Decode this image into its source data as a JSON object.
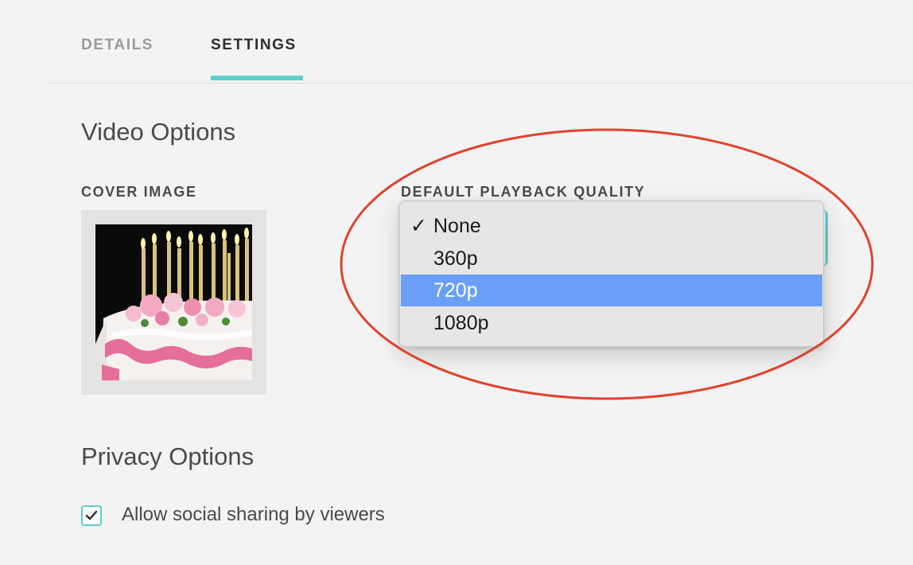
{
  "tabs": {
    "details": "DETAILS",
    "settings": "SETTINGS",
    "active": "SETTINGS"
  },
  "video_options": {
    "title": "Video Options",
    "cover_image_label": "COVER IMAGE",
    "playback_quality_label": "DEFAULT PLAYBACK QUALITY",
    "playback_quality": {
      "checked": "None",
      "highlighted": "720p",
      "options": [
        {
          "label": "None",
          "checked": true,
          "highlighted": false
        },
        {
          "label": "360p",
          "checked": false,
          "highlighted": false
        },
        {
          "label": "720p",
          "checked": false,
          "highlighted": true
        },
        {
          "label": "1080p",
          "checked": false,
          "highlighted": false
        }
      ],
      "check_glyph": "✓"
    }
  },
  "privacy_options": {
    "title": "Privacy Options",
    "allow_social_sharing": {
      "label": "Allow social sharing by viewers",
      "checked": true
    }
  },
  "colors": {
    "accent": "#5ccfcc",
    "highlight": "#6a9ff7",
    "annotation": "#e0432d"
  },
  "icons": {
    "checkmark": "checkmark-icon",
    "cover_image": "birthday-cake-image"
  }
}
